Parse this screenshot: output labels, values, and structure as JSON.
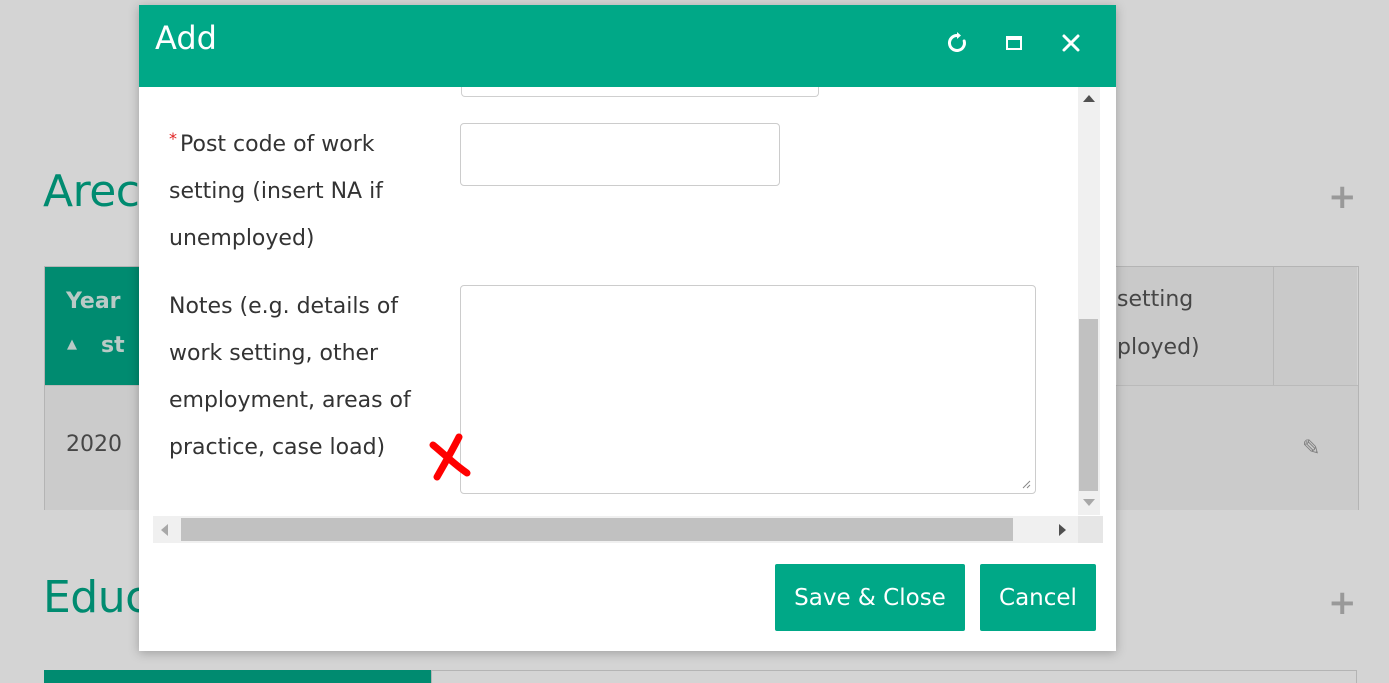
{
  "background": {
    "section1_title_fragment": "Arec",
    "section2_title_fragment": "Educ",
    "add_icon": "plus-icon",
    "table": {
      "header_col1_line1": "Year",
      "header_col1_line2": "st",
      "header_col1_sort_icon": "sort-ascending-icon",
      "header_right_line1": "setting",
      "header_right_line2": "ployed)",
      "row1_year": "2020",
      "row_edit_icon": "pencil-icon"
    }
  },
  "dialog": {
    "title": "Add",
    "header_icons": [
      "refresh-icon",
      "maximize-icon",
      "close-icon"
    ],
    "fields": {
      "postcode": {
        "required_marker": "*",
        "label_lines": [
          "Post code of work",
          "setting (insert NA if",
          "unemployed)"
        ],
        "value": ""
      },
      "notes": {
        "label_lines": [
          "Notes (e.g. details of",
          "work setting, other",
          "employment, areas of",
          "practice, case load)"
        ],
        "value": ""
      }
    },
    "annotation": "red-x-mark",
    "footer": {
      "save_label": "Save & Close",
      "cancel_label": "Cancel"
    }
  },
  "colors": {
    "brand": "#00a887",
    "required": "#e02020",
    "annotation": "#ff0000"
  }
}
